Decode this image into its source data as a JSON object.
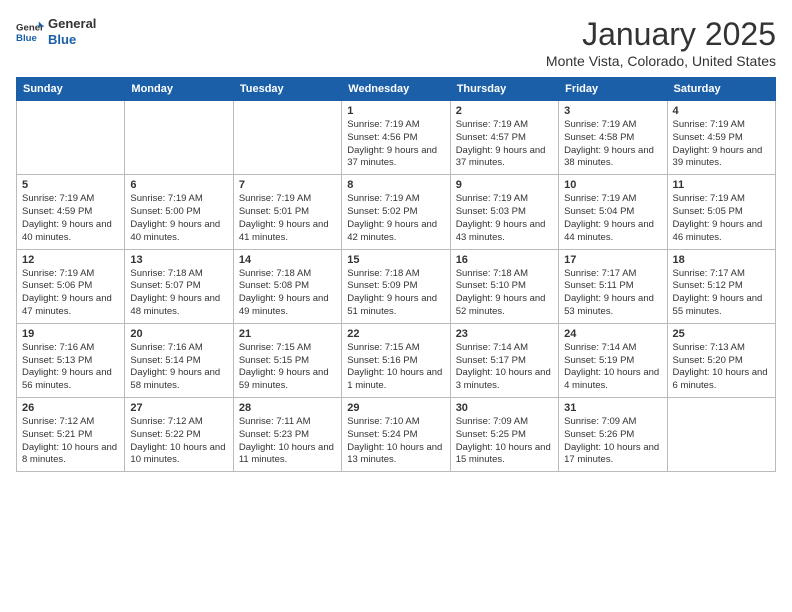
{
  "header": {
    "logo_general": "General",
    "logo_blue": "Blue",
    "title": "January 2025",
    "location": "Monte Vista, Colorado, United States"
  },
  "days_of_week": [
    "Sunday",
    "Monday",
    "Tuesday",
    "Wednesday",
    "Thursday",
    "Friday",
    "Saturday"
  ],
  "weeks": [
    [
      {
        "day": "",
        "content": ""
      },
      {
        "day": "",
        "content": ""
      },
      {
        "day": "",
        "content": ""
      },
      {
        "day": "1",
        "content": "Sunrise: 7:19 AM\nSunset: 4:56 PM\nDaylight: 9 hours and 37 minutes."
      },
      {
        "day": "2",
        "content": "Sunrise: 7:19 AM\nSunset: 4:57 PM\nDaylight: 9 hours and 37 minutes."
      },
      {
        "day": "3",
        "content": "Sunrise: 7:19 AM\nSunset: 4:58 PM\nDaylight: 9 hours and 38 minutes."
      },
      {
        "day": "4",
        "content": "Sunrise: 7:19 AM\nSunset: 4:59 PM\nDaylight: 9 hours and 39 minutes."
      }
    ],
    [
      {
        "day": "5",
        "content": "Sunrise: 7:19 AM\nSunset: 4:59 PM\nDaylight: 9 hours and 40 minutes."
      },
      {
        "day": "6",
        "content": "Sunrise: 7:19 AM\nSunset: 5:00 PM\nDaylight: 9 hours and 40 minutes."
      },
      {
        "day": "7",
        "content": "Sunrise: 7:19 AM\nSunset: 5:01 PM\nDaylight: 9 hours and 41 minutes."
      },
      {
        "day": "8",
        "content": "Sunrise: 7:19 AM\nSunset: 5:02 PM\nDaylight: 9 hours and 42 minutes."
      },
      {
        "day": "9",
        "content": "Sunrise: 7:19 AM\nSunset: 5:03 PM\nDaylight: 9 hours and 43 minutes."
      },
      {
        "day": "10",
        "content": "Sunrise: 7:19 AM\nSunset: 5:04 PM\nDaylight: 9 hours and 44 minutes."
      },
      {
        "day": "11",
        "content": "Sunrise: 7:19 AM\nSunset: 5:05 PM\nDaylight: 9 hours and 46 minutes."
      }
    ],
    [
      {
        "day": "12",
        "content": "Sunrise: 7:19 AM\nSunset: 5:06 PM\nDaylight: 9 hours and 47 minutes."
      },
      {
        "day": "13",
        "content": "Sunrise: 7:18 AM\nSunset: 5:07 PM\nDaylight: 9 hours and 48 minutes."
      },
      {
        "day": "14",
        "content": "Sunrise: 7:18 AM\nSunset: 5:08 PM\nDaylight: 9 hours and 49 minutes."
      },
      {
        "day": "15",
        "content": "Sunrise: 7:18 AM\nSunset: 5:09 PM\nDaylight: 9 hours and 51 minutes."
      },
      {
        "day": "16",
        "content": "Sunrise: 7:18 AM\nSunset: 5:10 PM\nDaylight: 9 hours and 52 minutes."
      },
      {
        "day": "17",
        "content": "Sunrise: 7:17 AM\nSunset: 5:11 PM\nDaylight: 9 hours and 53 minutes."
      },
      {
        "day": "18",
        "content": "Sunrise: 7:17 AM\nSunset: 5:12 PM\nDaylight: 9 hours and 55 minutes."
      }
    ],
    [
      {
        "day": "19",
        "content": "Sunrise: 7:16 AM\nSunset: 5:13 PM\nDaylight: 9 hours and 56 minutes."
      },
      {
        "day": "20",
        "content": "Sunrise: 7:16 AM\nSunset: 5:14 PM\nDaylight: 9 hours and 58 minutes."
      },
      {
        "day": "21",
        "content": "Sunrise: 7:15 AM\nSunset: 5:15 PM\nDaylight: 9 hours and 59 minutes."
      },
      {
        "day": "22",
        "content": "Sunrise: 7:15 AM\nSunset: 5:16 PM\nDaylight: 10 hours and 1 minute."
      },
      {
        "day": "23",
        "content": "Sunrise: 7:14 AM\nSunset: 5:17 PM\nDaylight: 10 hours and 3 minutes."
      },
      {
        "day": "24",
        "content": "Sunrise: 7:14 AM\nSunset: 5:19 PM\nDaylight: 10 hours and 4 minutes."
      },
      {
        "day": "25",
        "content": "Sunrise: 7:13 AM\nSunset: 5:20 PM\nDaylight: 10 hours and 6 minutes."
      }
    ],
    [
      {
        "day": "26",
        "content": "Sunrise: 7:12 AM\nSunset: 5:21 PM\nDaylight: 10 hours and 8 minutes."
      },
      {
        "day": "27",
        "content": "Sunrise: 7:12 AM\nSunset: 5:22 PM\nDaylight: 10 hours and 10 minutes."
      },
      {
        "day": "28",
        "content": "Sunrise: 7:11 AM\nSunset: 5:23 PM\nDaylight: 10 hours and 11 minutes."
      },
      {
        "day": "29",
        "content": "Sunrise: 7:10 AM\nSunset: 5:24 PM\nDaylight: 10 hours and 13 minutes."
      },
      {
        "day": "30",
        "content": "Sunrise: 7:09 AM\nSunset: 5:25 PM\nDaylight: 10 hours and 15 minutes."
      },
      {
        "day": "31",
        "content": "Sunrise: 7:09 AM\nSunset: 5:26 PM\nDaylight: 10 hours and 17 minutes."
      },
      {
        "day": "",
        "content": ""
      }
    ]
  ]
}
